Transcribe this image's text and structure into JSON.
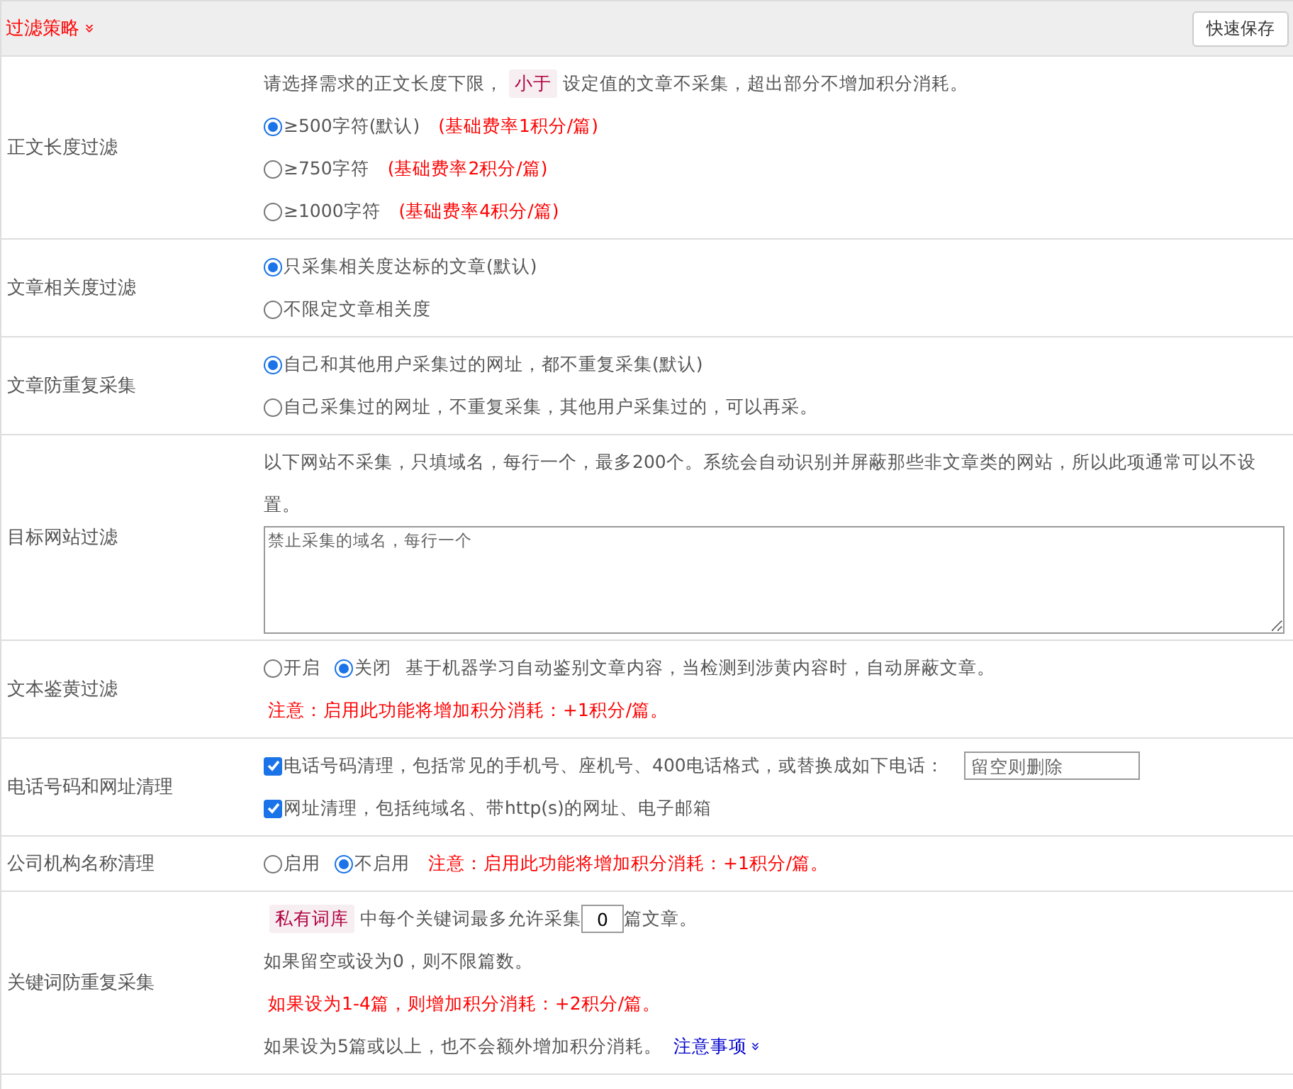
{
  "header": {
    "title": "过滤策略",
    "toggle": "»",
    "save_button": "快速保存"
  },
  "sections": [
    {
      "label": "正文长度过滤",
      "lines": [
        [
          {
            "kind": "text",
            "text": "请选择需求的正文长度下限，"
          },
          {
            "kind": "tag",
            "text": "小于"
          },
          {
            "kind": "text",
            "text": "设定值的文章不采集，超出部分不增加积分消耗。"
          }
        ],
        [
          {
            "kind": "radio",
            "selected": true,
            "text": "≥500字符(默认)"
          },
          {
            "kind": "note",
            "text": "(基础费率1积分/篇)"
          }
        ],
        [
          {
            "kind": "radio",
            "selected": false,
            "text": "≥750字符"
          },
          {
            "kind": "note",
            "text": "(基础费率2积分/篇)"
          }
        ],
        [
          {
            "kind": "radio",
            "selected": false,
            "text": "≥1000字符"
          },
          {
            "kind": "note",
            "text": "(基础费率4积分/篇)"
          }
        ]
      ]
    },
    {
      "label": "文章相关度过滤",
      "lines": [
        [
          {
            "kind": "radio",
            "selected": true,
            "text": "只采集相关度达标的文章(默认)"
          }
        ],
        [
          {
            "kind": "radio",
            "selected": false,
            "text": "不限定文章相关度"
          }
        ]
      ]
    },
    {
      "label": "文章防重复采集",
      "lines": [
        [
          {
            "kind": "radio",
            "selected": true,
            "text": "自己和其他用户采集过的网址，都不重复采集(默认)"
          }
        ],
        [
          {
            "kind": "radio",
            "selected": false,
            "text": "自己采集过的网址，不重复采集，其他用户采集过的，可以再采。"
          }
        ]
      ]
    },
    {
      "label": "目标网站过滤",
      "lines": [
        [
          {
            "kind": "text",
            "text": "以下网站不采集，只填域名，每行一个，最多200个。系统会自动识别并屏蔽那些非文章类的网站，所以此项通常可以不设置。"
          }
        ],
        [
          {
            "kind": "textarea",
            "placeholder": "禁止采集的域名，每行一个"
          }
        ]
      ]
    },
    {
      "label": "文本鉴黄过滤",
      "lines": [
        [
          {
            "kind": "radio",
            "selected": false,
            "text": "开启"
          },
          {
            "kind": "radio",
            "selected": true,
            "text": "关闭"
          },
          {
            "kind": "text",
            "text": "基于机器学习自动鉴别文章内容，当检测到涉黄内容时，自动屏蔽文章。"
          }
        ],
        [
          {
            "kind": "note",
            "text": "注意：启用此功能将增加积分消耗：+1积分/篇。"
          }
        ]
      ]
    },
    {
      "label": "电话号码和网址清理",
      "lines": [
        [
          {
            "kind": "checkbox",
            "checked": true,
            "text": "电话号码清理，包括常见的手机号、座机号、400电话格式，或替换成如下电话："
          },
          {
            "kind": "input",
            "placeholder": "留空则删除"
          }
        ],
        [
          {
            "kind": "checkbox",
            "checked": true,
            "text": "网址清理，包括纯域名、带http(s)的网址、电子邮箱"
          }
        ]
      ]
    },
    {
      "label": "公司机构名称清理",
      "lines": [
        [
          {
            "kind": "radio",
            "selected": false,
            "text": "启用"
          },
          {
            "kind": "radio",
            "selected": true,
            "text": "不启用"
          },
          {
            "kind": "note",
            "text": "注意：启用此功能将增加积分消耗：+1积分/篇。"
          }
        ]
      ]
    },
    {
      "label": "关键词防重复采集",
      "lines": [
        [
          {
            "kind": "tag",
            "text": "私有词库"
          },
          {
            "kind": "text",
            "text": "中每个关键词最多允许采集"
          },
          {
            "kind": "number",
            "value": "0"
          },
          {
            "kind": "text",
            "text": "篇文章。"
          }
        ],
        [
          {
            "kind": "text",
            "text": "如果留空或设为0，则不限篇数。"
          }
        ],
        [
          {
            "kind": "note",
            "text": "如果设为1-4篇，则增加积分消耗：+2积分/篇。"
          }
        ],
        [
          {
            "kind": "text",
            "text": "如果设为5篇或以上，也不会额外增加积分消耗。"
          },
          {
            "kind": "link",
            "text": "注意事项",
            "toggle": "»"
          }
        ]
      ]
    }
  ]
}
